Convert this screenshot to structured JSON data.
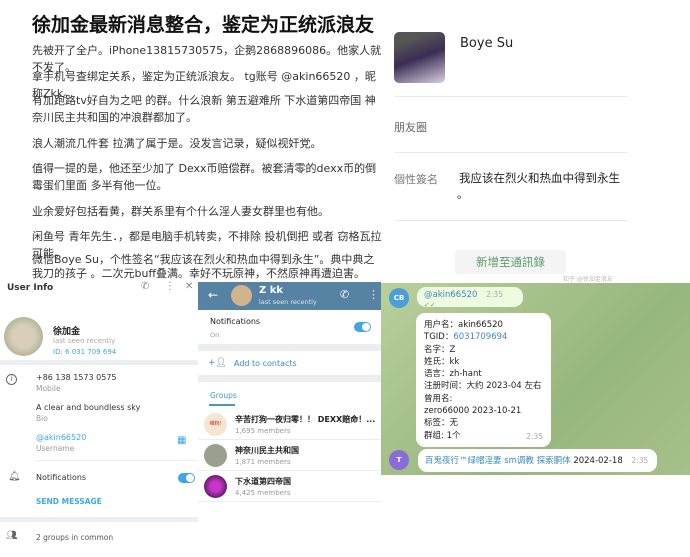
{
  "article": {
    "title": "徐加金最新消息整合，鉴定为正统派浪友",
    "paragraphs": [
      "先被开了全户。iPhone13815730575，企鹅2868896086。他家人就不发了。",
      "拿手机号查绑定关系，鉴定为正统派浪友。 tg账号 @akin66520 ，昵称Zkk。",
      "有加跑路tv好自为之吧 的群。什么浪新 第五避难所 下水道第四帝国 神奈川民主共和国的冲浪群都加了。",
      "浪人潮流几件套 拉满了属于是。没发言记录，疑似视奸党。",
      "值得一提的是，他还至少加了 Dexx币赔偿群。被套清零的dexx币的倒霉蛋们里面 多半有他一位。",
      "业余爱好包括看黄，群关系里有个什么淫人妻女群里也有他。",
      "闲鱼号 青年先生．，都是电脑手机转卖，不排除 投机倒把 或者 窃格瓦拉 可能。",
      "微信Boye Su，个性签名“我应该在烈火和热血中得到永生”。典中典之 我刀的孩子 。二次元buff叠满。幸好不玩原神，不然原神再遭迫害。"
    ]
  },
  "user_info": {
    "title": "User Info",
    "name": "徐加金",
    "status": "last seen recently",
    "id": "ID: 6 031 709 694",
    "phone": "+86 138 1573 0575",
    "phone_label": "Mobile",
    "bio": "A clear and boundless sky",
    "bio_label": "Bio",
    "username": "@akin66520",
    "username_label": "Username",
    "notifications": "Notifications",
    "notifications_on": true,
    "send_message": "SEND MESSAGE",
    "groups_common": "2 groups in common"
  },
  "zk_profile": {
    "name": "Z kk",
    "status": "last seen recently",
    "notifications": "Notifications",
    "notifications_state": "On",
    "add_contacts": "Add to contacts",
    "groups_tab": "Groups",
    "groups": [
      {
        "name": "辛苦打狗一夜归零！！ DEXX赔命！...",
        "members": "1,695 members",
        "badge": "维权!"
      },
      {
        "name": "神奈川民主共和国",
        "members": "1,871 members"
      },
      {
        "name": "下水道第四帝国",
        "members": "4,425 members"
      }
    ]
  },
  "chat": {
    "msg1": {
      "avatar": "CB",
      "text": "@akin66520",
      "time": "2:35"
    },
    "msg2": {
      "lines": [
        "用户名：akin66520",
        "名字：Z",
        "姓氏：kk",
        "语言：zh-hant",
        "注册时间：大约 2023-04 左右",
        "曾用名:",
        "zero66000 2023-10-21",
        "标签：无",
        "群组: 1个"
      ],
      "tgid_label": "TGID：",
      "tgid": "6031709694",
      "time": "2:35"
    },
    "msg3": {
      "avatar": "T",
      "link": "百鬼夜行™绿帽淫妻 sm调教 探索胴体",
      "date": "2024-02-18",
      "time": "2:35"
    }
  },
  "wechat": {
    "name": "Boye Su",
    "moments": "朋友圈",
    "signature_label": "個性簽名",
    "signature": "我应该在烈火和热血中得到永生",
    "signature_end": "。",
    "add_button": "新增至通訊錄",
    "watermark": "知乎 @徐加金浪友"
  },
  "colors": {
    "telegram_blue": "#5682a3",
    "link": "#40a7e3",
    "wechat_green": "#5a9a6f"
  }
}
